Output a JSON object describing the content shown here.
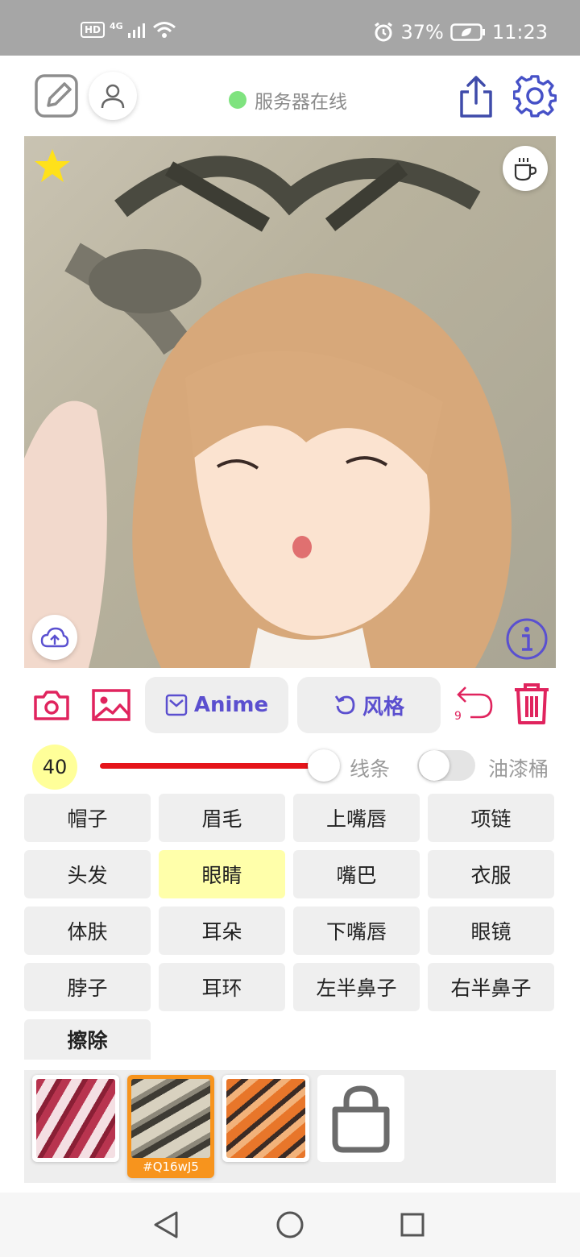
{
  "status_bar": {
    "network_badge": "HD",
    "network_type": "4G",
    "battery": "37%",
    "time": "11:23",
    "icons": [
      "signal-icon",
      "wifi-icon",
      "alarm-icon",
      "battery-icon"
    ]
  },
  "header": {
    "server_status": "服务器在线",
    "server_status_color": "#7fe37f",
    "icons": [
      "edit-icon",
      "user-icon",
      "share-icon",
      "settings-icon"
    ]
  },
  "canvas": {
    "favorite_icon": "star-icon",
    "coffee_icon": "coffee-icon",
    "upload_icon": "cloud-upload-icon",
    "info_icon": "info-icon"
  },
  "toolbar": {
    "anime_label": "Anime",
    "style_label": "风格",
    "undo_count": "9",
    "accent_color": "#e0245e",
    "primary_color": "#5b4fcf"
  },
  "brush": {
    "size": "40",
    "size_fraction": 0.93,
    "line_label": "线条",
    "bucket_label": "油漆桶",
    "bucket_enabled": false
  },
  "parts": {
    "items": [
      "帽子",
      "眉毛",
      "上嘴唇",
      "项链",
      "头发",
      "眼睛",
      "嘴巴",
      "衣服",
      "体肤",
      "耳朵",
      "下嘴唇",
      "眼镜",
      "脖子",
      "耳环",
      "左半鼻子",
      "右半鼻子"
    ],
    "selected": "眼睛",
    "erase_label": "擦除"
  },
  "swatches": {
    "selected_id": "#Q16wJ5",
    "store_icon": "shopping-bag-icon"
  },
  "navbar": {
    "icons": [
      "back-icon",
      "home-icon",
      "recents-icon"
    ]
  }
}
